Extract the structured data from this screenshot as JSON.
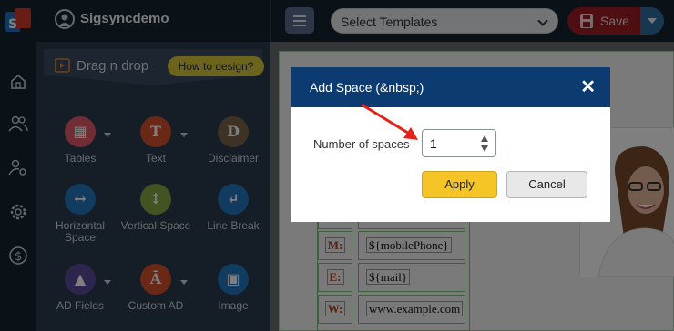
{
  "header": {
    "app_name": "Sigsyncdemo",
    "template_select": "Select Templates",
    "save_label": "Save"
  },
  "left_rail": {
    "icons": [
      "home-icon",
      "users-icon",
      "user-settings-icon",
      "gear-icon",
      "dollar-icon"
    ]
  },
  "panel": {
    "title": "Drag n drop",
    "howto_label": "How to design?",
    "tools": [
      {
        "label": "Tables",
        "icon": "table-icon",
        "color": "#e05a66",
        "glyph": "▦"
      },
      {
        "label": "Text",
        "icon": "text-icon",
        "color": "#d2522d",
        "glyph": "T"
      },
      {
        "label": "Disclaimer",
        "icon": "disclaimer-icon",
        "color": "#7a6448",
        "glyph": "D"
      },
      {
        "label": "Horizontal Space",
        "icon": "horizontal-space-icon",
        "color": "#2379be",
        "glyph": "↔"
      },
      {
        "label": "Vertical Space",
        "icon": "vertical-space-icon",
        "color": "#87a645",
        "glyph": "↕"
      },
      {
        "label": "Line Break",
        "icon": "line-break-icon",
        "color": "#2379be",
        "glyph": "↵"
      },
      {
        "label": "AD Fields",
        "icon": "ad-fields-icon",
        "color": "#5b4a9c",
        "glyph": "▲"
      },
      {
        "label": "Custom AD",
        "icon": "custom-ad-icon",
        "color": "#d2522d",
        "glyph": "Ā"
      },
      {
        "label": "Image",
        "icon": "image-icon",
        "color": "#2379be",
        "glyph": "▣"
      }
    ]
  },
  "signature": {
    "rows": [
      {
        "label": "M:",
        "value": "${mobilePhone}"
      },
      {
        "label": "E:",
        "value": "${mail}"
      },
      {
        "label": "W:",
        "value": "www.example.com"
      }
    ]
  },
  "modal": {
    "title": "Add Space (&nbsp;)",
    "field_label": "Number of spaces",
    "field_value": "1",
    "apply_label": "Apply",
    "cancel_label": "Cancel",
    "header_color": "#0b3b70",
    "apply_color": "#f5c527"
  }
}
